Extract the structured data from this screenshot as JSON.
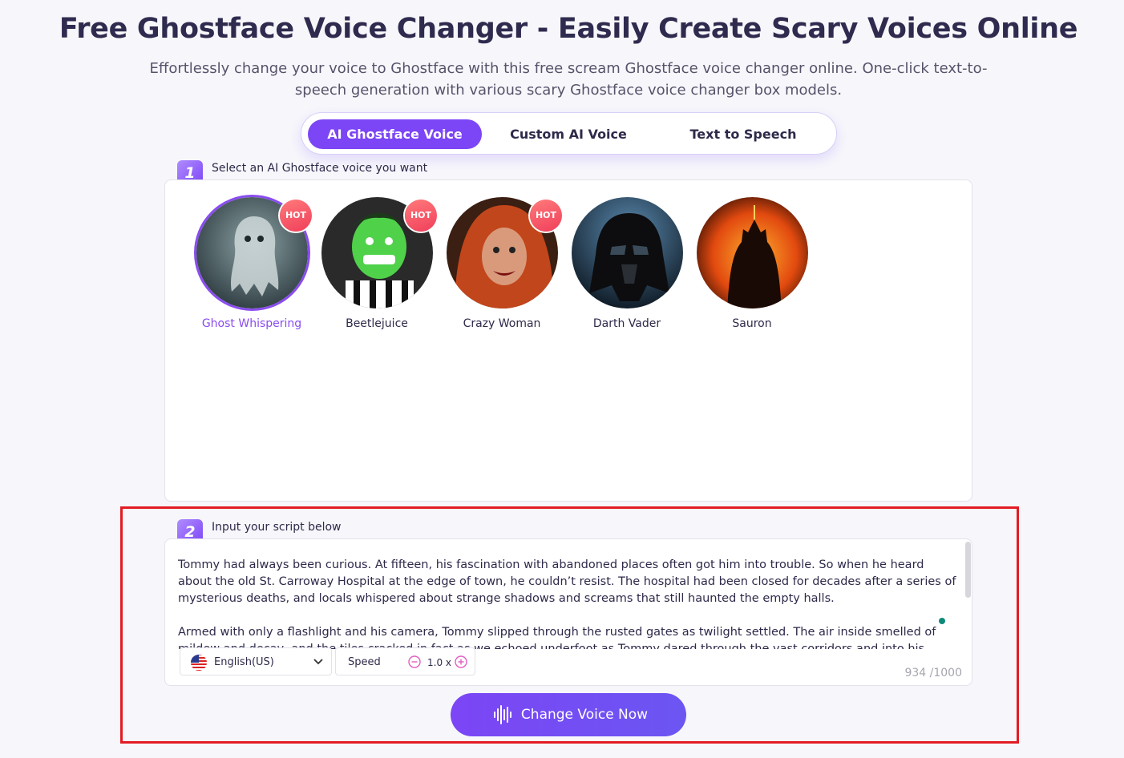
{
  "header": {
    "title": "Free Ghostface Voice Changer - Easily Create Scary Voices Online",
    "subtitle": "Effortlessly change your voice to Ghostface with this free scream Ghostface voice changer online. One-click text-to-speech generation with various scary Ghostface voice changer box models."
  },
  "tabs": [
    {
      "label": "AI Ghostface Voice",
      "active": true
    },
    {
      "label": "Custom AI Voice",
      "active": false
    },
    {
      "label": "Text to Speech",
      "active": false
    }
  ],
  "step1": {
    "number": "1",
    "label": "Select an AI Ghostface voice you want",
    "voices": [
      {
        "name": "Ghost Whispering",
        "badge": "HOT",
        "selected": true
      },
      {
        "name": "Beetlejuice",
        "badge": "HOT",
        "selected": false
      },
      {
        "name": "Crazy Woman",
        "badge": "HOT",
        "selected": false
      },
      {
        "name": "Darth Vader",
        "badge": "",
        "selected": false
      },
      {
        "name": "Sauron",
        "badge": "",
        "selected": false
      }
    ]
  },
  "step2": {
    "number": "2",
    "label": "Input your script below",
    "paragraphs": [
      "Tommy had always been curious. At fifteen, his fascination with abandoned places often got him into trouble. So when he heard about the old St. Carroway Hospital at the edge of town, he couldn’t resist. The hospital had been closed for decades after a series of mysterious deaths, and locals whispered about strange shadows and screams that still haunted the empty halls.",
      "Armed with only a flashlight and his camera, Tommy slipped through the rusted gates as twilight settled. The air inside smelled of mildew and decay, and the tiles cracked in fact as we echoed underfoot as Tommy dared through the vast corridors and into his..."
    ],
    "language": "English(US)",
    "speed_label": "Speed",
    "speed_value": "1.0 x",
    "char_count": "934 /1000"
  },
  "cta_label": "Change Voice Now",
  "colors": {
    "accent": "#7c45f5",
    "hot": "#f03f5b",
    "highlight": "#e31b23"
  }
}
